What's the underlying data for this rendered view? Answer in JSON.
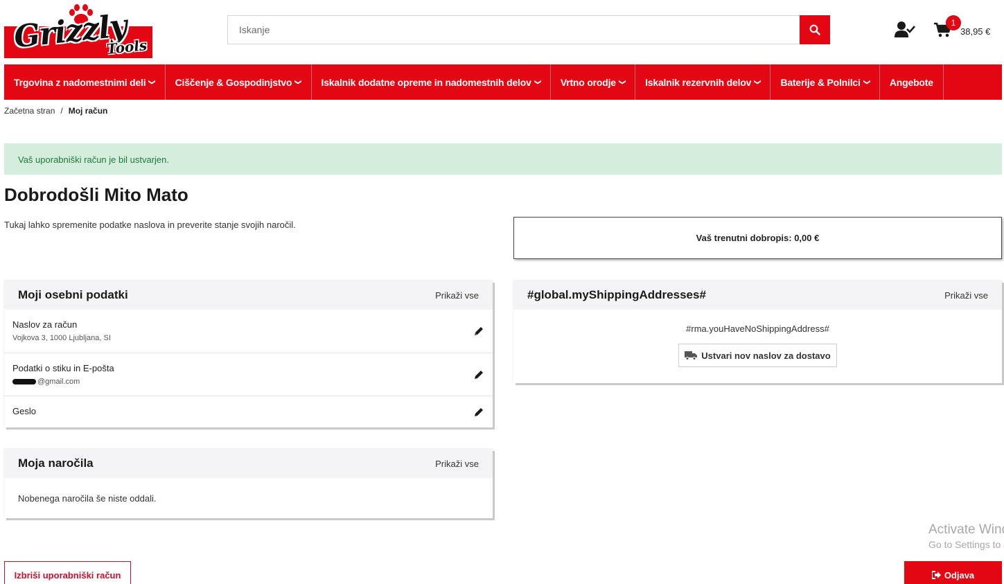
{
  "logo": {
    "main": "Grizzly",
    "sub": "Tools",
    "brand_color": "#e30613"
  },
  "search": {
    "placeholder": "Iskanje",
    "icon": "search-icon"
  },
  "header": {
    "user_icon": "user-check-icon",
    "cart": {
      "count": "1",
      "total": "38,95 €",
      "icon": "shopping-cart-icon"
    }
  },
  "nav": {
    "items": [
      {
        "label": "Trgovina z nadomestnimi deli",
        "has_dropdown": true
      },
      {
        "label": "Ciščenje & Gospodinjstvo",
        "has_dropdown": true
      },
      {
        "label": "Iskalnik dodatne opreme in nadomestnih delov",
        "has_dropdown": true
      },
      {
        "label": "Vrtno orodje",
        "has_dropdown": true
      },
      {
        "label": "Iskalnik rezervnih delov",
        "has_dropdown": true
      },
      {
        "label": "Baterije & Polnilci",
        "has_dropdown": true
      },
      {
        "label": "Angebote",
        "has_dropdown": false
      }
    ]
  },
  "breadcrumb": {
    "home": "Začetna stran",
    "separator": "/",
    "current": "Moj račun"
  },
  "alert": {
    "message": "Vaš uporabniški račun je bil ustvarjen."
  },
  "welcome": {
    "title": "Dobrodošli Mito Mato",
    "subtitle": "Tukaj lahko spremenite podatke naslova in preverite stanje svojih naročil."
  },
  "credit": {
    "label": "Vaš trenutni dobropis: 0,00 €"
  },
  "personal": {
    "title": "Moji osebni podatki",
    "show_all": "Prikaži vse",
    "rows": [
      {
        "label": "Naslov za račun",
        "sub": "Vojkova 3, 1000 Ljubljana, SI"
      },
      {
        "label": "Podatki o stiku in E-pošta",
        "sub": "@gmail.com"
      },
      {
        "label": "Geslo"
      }
    ]
  },
  "shipping": {
    "title": "#global.myShippingAddresses#",
    "show_all": "Prikaži vse",
    "message": "#rma.youHaveNoShippingAddress#",
    "button": "Ustvari nov naslov za dostavo"
  },
  "orders": {
    "title": "Moja naročila",
    "show_all": "Prikaži vse",
    "empty": "Nobenega naročila še niste oddali."
  },
  "actions": {
    "delete": "Izbriši uporabniški račun",
    "logout": "Odjava"
  },
  "watermark": {
    "line1": "Activate Windows",
    "line2": "Go to Settings to activate Windows."
  }
}
